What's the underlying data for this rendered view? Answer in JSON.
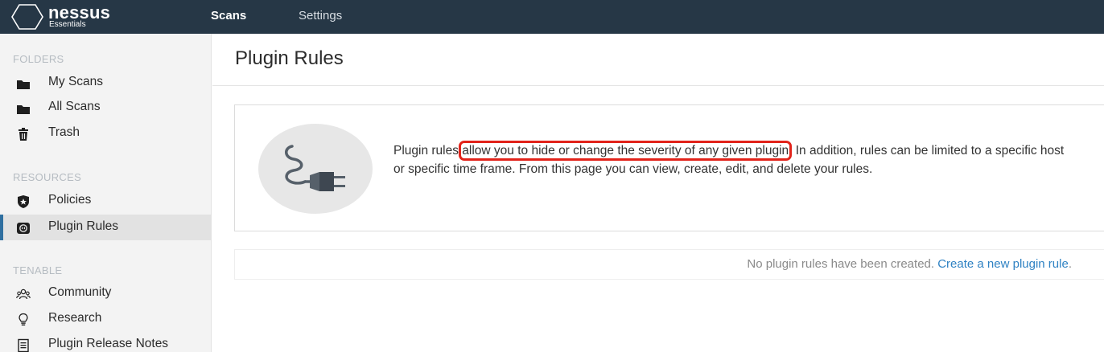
{
  "app": {
    "brand": "nessus",
    "edition": "Essentials",
    "colors": {
      "topbar": "#263746",
      "accent": "#2f6fa0",
      "link": "#2f82c3",
      "highlight": "#e2231a"
    }
  },
  "nav": {
    "tabs": [
      {
        "label": "Scans"
      },
      {
        "label": "Settings"
      }
    ]
  },
  "sidebar": {
    "folders_label": "FOLDERS",
    "folders": [
      {
        "label": "My Scans",
        "icon": "folder-icon"
      },
      {
        "label": "All Scans",
        "icon": "folder-icon"
      },
      {
        "label": "Trash",
        "icon": "trash-icon"
      }
    ],
    "resources_label": "RESOURCES",
    "resources": [
      {
        "label": "Policies",
        "icon": "policy-shield-icon"
      },
      {
        "label": "Plugin Rules",
        "icon": "plugin-rules-icon",
        "active": true
      }
    ],
    "tenable_label": "TENABLE",
    "tenable": [
      {
        "label": "Community",
        "icon": "community-icon"
      },
      {
        "label": "Research",
        "icon": "lightbulb-icon"
      },
      {
        "label": "Plugin Release Notes",
        "icon": "release-notes-icon"
      }
    ]
  },
  "main": {
    "title": "Plugin Rules",
    "info": {
      "text_before": "Plugin rules ",
      "text_highlight": "allow you to hide or change the severity of any given plugin",
      "text_after": ". In addition, rules can be limited to a specific host or specific time frame. From this page you can view, create, edit, and delete your rules.",
      "icon": "plug-icon"
    },
    "empty": {
      "message": "No plugin rules have been created. ",
      "link": "Create a new plugin rule",
      "after_link": "."
    }
  }
}
